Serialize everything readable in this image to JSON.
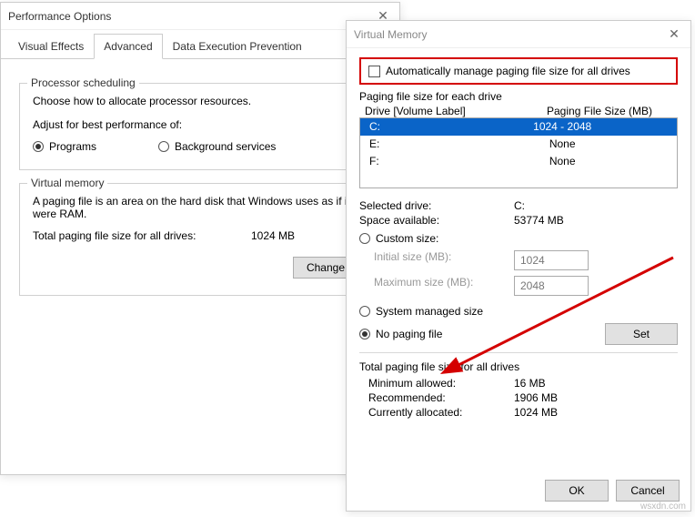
{
  "perf": {
    "title": "Performance Options",
    "tabs": [
      "Visual Effects",
      "Advanced",
      "Data Execution Prevention"
    ],
    "active_tab": 1,
    "proc_sched": {
      "title": "Processor scheduling",
      "desc": "Choose how to allocate processor resources.",
      "adjust_label": "Adjust for best performance of:",
      "opt_programs": "Programs",
      "opt_bg": "Background services"
    },
    "vmem": {
      "title": "Virtual memory",
      "desc": "A paging file is an area on the hard disk that Windows uses as if it were RAM.",
      "total_label": "Total paging file size for all drives:",
      "total_value": "1024 MB",
      "change_btn": "Change..."
    }
  },
  "vmem_dlg": {
    "title": "Virtual Memory",
    "auto_label": "Automatically manage paging file size for all drives",
    "paging_group": "Paging file size for each drive",
    "hdr_drive": "Drive  [Volume Label]",
    "hdr_size": "Paging File Size (MB)",
    "drives": [
      {
        "d": "C:",
        "s": "1024 - 2048"
      },
      {
        "d": "E:",
        "s": "None"
      },
      {
        "d": "F:",
        "s": "None"
      }
    ],
    "selected_drive_label": "Selected drive:",
    "selected_drive_value": "C:",
    "space_label": "Space available:",
    "space_value": "53774 MB",
    "custom_label": "Custom size:",
    "initial_label": "Initial size (MB):",
    "initial_val": "1024",
    "max_label": "Maximum size (MB):",
    "max_val": "2048",
    "sys_managed": "System managed size",
    "no_paging": "No paging file",
    "set_btn": "Set",
    "totals_hdr": "Total paging file size for all drives",
    "min_label": "Minimum allowed:",
    "min_val": "16 MB",
    "rec_label": "Recommended:",
    "rec_val": "1906 MB",
    "cur_label": "Currently allocated:",
    "cur_val": "1024 MB",
    "ok": "OK",
    "cancel": "Cancel"
  },
  "watermark": "wsxdn.com"
}
